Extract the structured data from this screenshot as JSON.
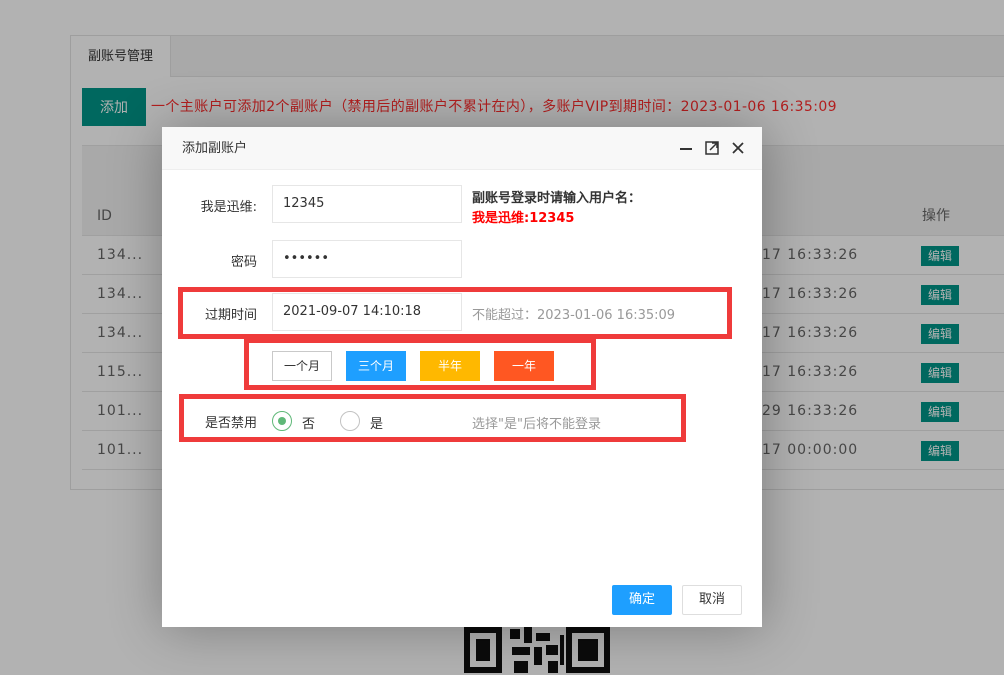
{
  "page": {
    "tab_label": "副账号管理",
    "add_button": "添加",
    "notice": "一个主账户可添加2个副账户（禁用后的副账户不累计在内），多账户VIP到期时间：2023-01-06 16:35:09",
    "table": {
      "col_id": "ID",
      "col_op": "操作",
      "edit_label": "编辑",
      "rows": [
        {
          "id": "134...",
          "time": "17 16:33:26"
        },
        {
          "id": "134...",
          "time": "17 16:33:26"
        },
        {
          "id": "134...",
          "time": "17 16:33:26"
        },
        {
          "id": "115...",
          "time": "17 16:33:26"
        },
        {
          "id": "101...",
          "time": "29 16:33:26"
        },
        {
          "id": "101...",
          "time": "17 00:00:00"
        }
      ]
    }
  },
  "dialog": {
    "title": "添加副账户",
    "username_label": "我是迅维:",
    "username_value": "12345",
    "username_hint_title": "副账号登录时请输入用户名：",
    "username_hint_value": "我是迅维:12345",
    "password_label": "密码",
    "password_value": "••••••",
    "expire_label": "过期时间",
    "expire_value": "2021-09-07 14:10:18",
    "expire_hint": "不能超过：2023-01-06 16:35:09",
    "quick_buttons": [
      {
        "label": "一个月",
        "color": "#ffffff"
      },
      {
        "label": "三个月",
        "color": "#1E9FFF"
      },
      {
        "label": "半年",
        "color": "#FFB800"
      },
      {
        "label": "一年",
        "color": "#FF5722"
      }
    ],
    "disable_label": "是否禁用",
    "disable_options": [
      {
        "label": "否",
        "selected": true
      },
      {
        "label": "是",
        "selected": false
      }
    ],
    "disable_hint": "选择\"是\"后将不能登录",
    "confirm_button": "确定",
    "cancel_button": "取消"
  },
  "colors": {
    "primary_green": "#009688",
    "notice_red": "#ff2d2d",
    "highlight_red": "#ef3b3b",
    "radio_green": "#5FB878"
  }
}
